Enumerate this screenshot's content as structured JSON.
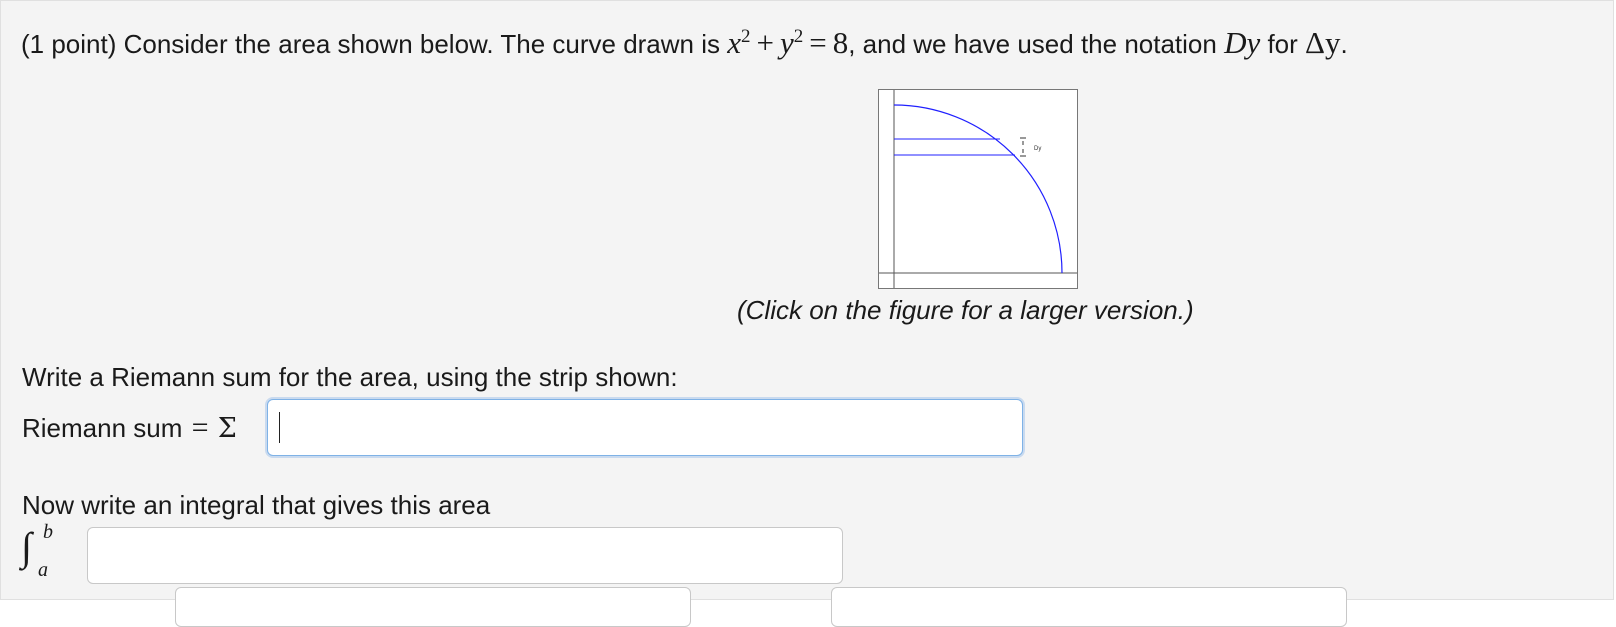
{
  "problem": {
    "prefix": "(1 point) Consider the area shown below. The curve drawn is ",
    "eq_x": "x",
    "eq_x_exp": "2",
    "eq_plus": "+",
    "eq_y": "y",
    "eq_y_exp": "2",
    "eq_equals": "=",
    "eq_rhs": "8",
    "middle": ", and we have used the notation ",
    "notation": "Dy",
    "for_text": " for ",
    "delta": "Δy",
    "end": "."
  },
  "figure": {
    "strip_label": "Dy",
    "caption": "(Click on the figure for a larger version.)"
  },
  "riemann": {
    "prompt": "Write a Riemann sum for the area, using the strip shown:",
    "label": "Riemann sum ",
    "equals": "=",
    "sigma": "Σ",
    "value": ""
  },
  "integral": {
    "prompt": "Now write an integral that gives this area",
    "symbol": "∫",
    "upper_limit_symbol": "b",
    "lower_limit_symbol": "a",
    "value": "",
    "lower_value": "",
    "upper_value": ""
  },
  "colors": {
    "curve": "#2020ff",
    "accent_focus": "#7fb2e6",
    "panel_bg": "#f4f4f4"
  }
}
